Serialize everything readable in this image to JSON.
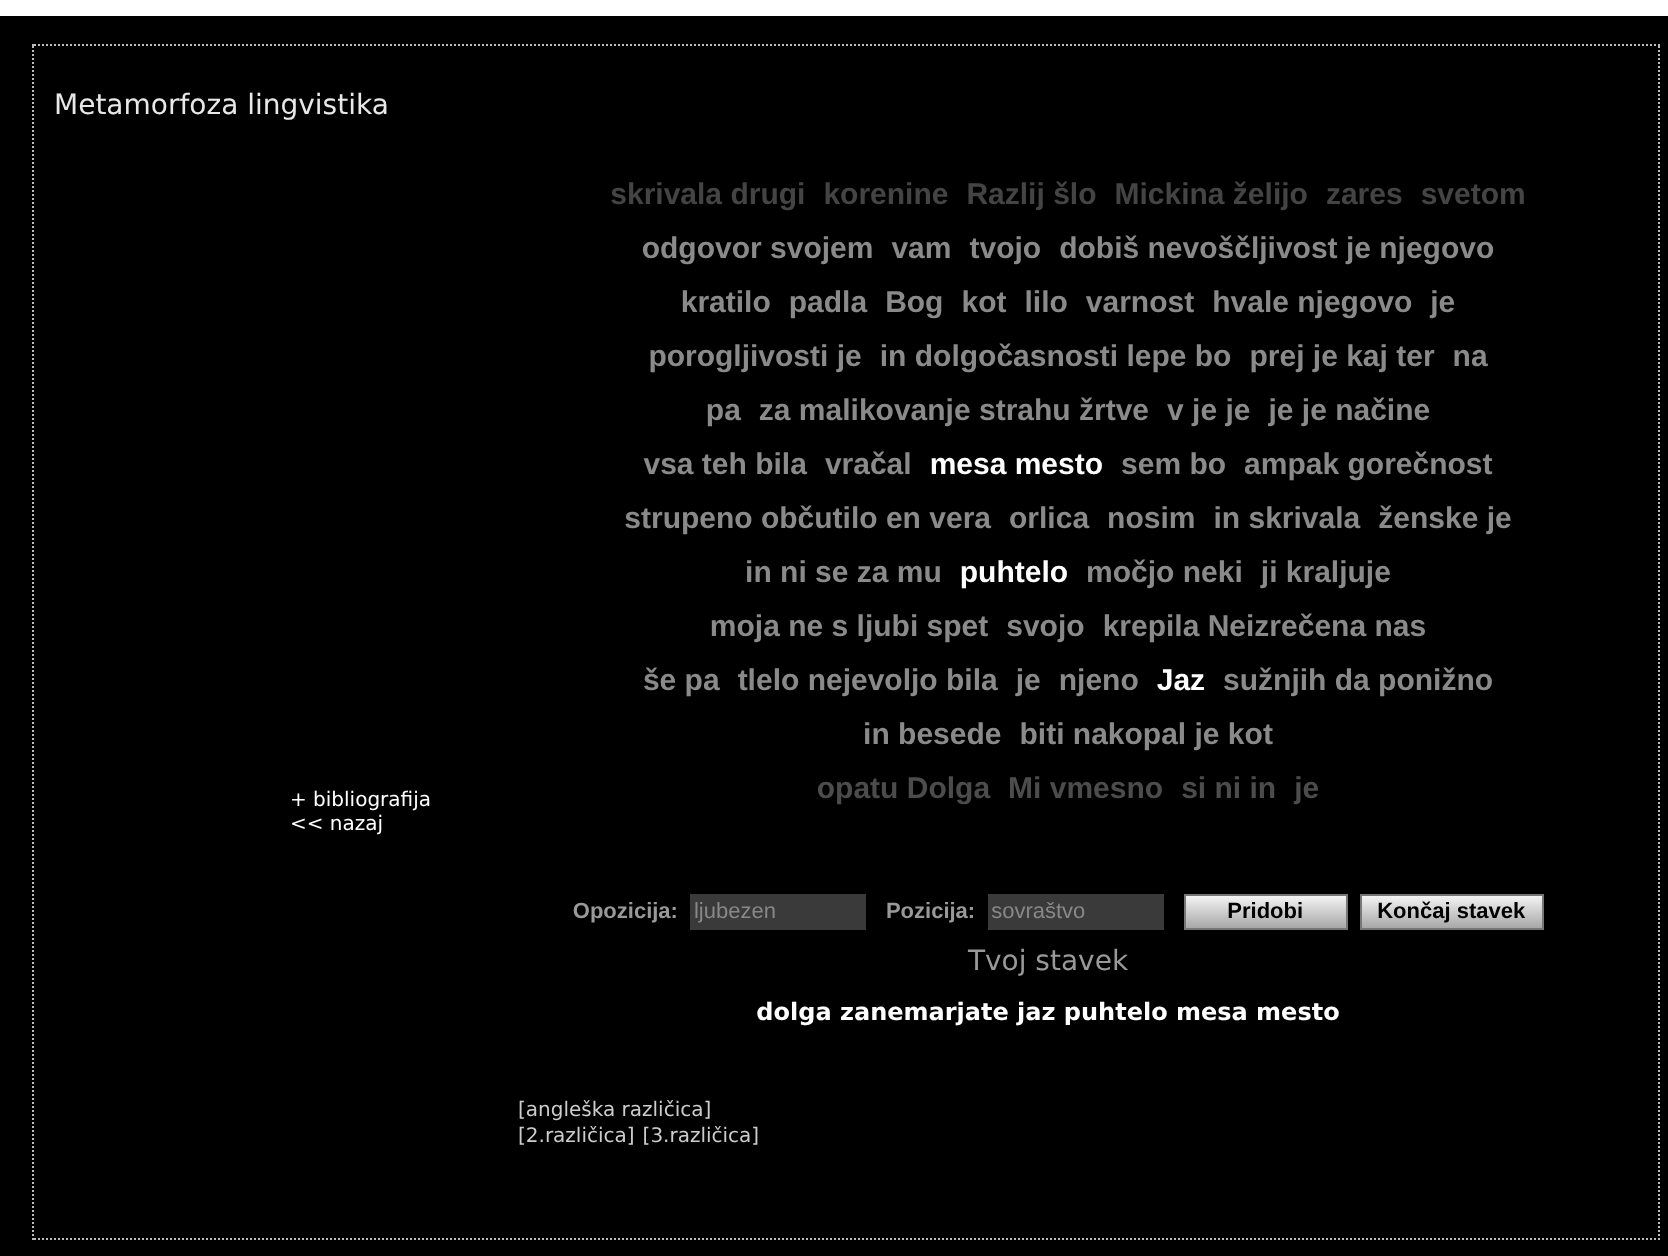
{
  "title": "Metamorfoza lingvistika",
  "nav_links": [
    "+ bibliografija",
    "<< nazaj"
  ],
  "word_cloud": [
    {
      "color": "#444444",
      "chunks": [
        {
          "text": "skrivala drugi",
          "highlighted": false
        },
        {
          "text": "korenine",
          "highlighted": false
        },
        {
          "text": "Razlij šlo",
          "highlighted": false
        },
        {
          "text": "Mickina želijo",
          "highlighted": false
        },
        {
          "text": "zares",
          "highlighted": false
        },
        {
          "text": "svetom",
          "highlighted": false
        }
      ]
    },
    {
      "color": "#8a8a8a",
      "chunks": [
        {
          "text": "odgovor svojem",
          "highlighted": false
        },
        {
          "text": "vam",
          "highlighted": false
        },
        {
          "text": "tvojo",
          "highlighted": false
        },
        {
          "text": "dobiš nevoščljivost je njegovo",
          "highlighted": false
        }
      ]
    },
    {
      "color": "#8a8a8a",
      "chunks": [
        {
          "text": "kratilo",
          "highlighted": false
        },
        {
          "text": "padla",
          "highlighted": false
        },
        {
          "text": "Bog",
          "highlighted": false
        },
        {
          "text": "kot",
          "highlighted": false
        },
        {
          "text": "lilo",
          "highlighted": false
        },
        {
          "text": "varnost",
          "highlighted": false
        },
        {
          "text": "hvale njegovo",
          "highlighted": false
        },
        {
          "text": "je",
          "highlighted": false
        }
      ]
    },
    {
      "color": "#8a8a8a",
      "chunks": [
        {
          "text": "porogljivosti je",
          "highlighted": false
        },
        {
          "text": "in dolgočasnosti lepe bo",
          "highlighted": false
        },
        {
          "text": "prej je kaj ter",
          "highlighted": false
        },
        {
          "text": "na",
          "highlighted": false
        }
      ]
    },
    {
      "color": "#8a8a8a",
      "chunks": [
        {
          "text": "pa",
          "highlighted": false
        },
        {
          "text": "za malikovanje strahu žrtve",
          "highlighted": false
        },
        {
          "text": "v je je",
          "highlighted": false
        },
        {
          "text": "je je načine",
          "highlighted": false
        }
      ]
    },
    {
      "color": "#8a8a8a",
      "chunks": [
        {
          "text": "vsa teh bila",
          "highlighted": false
        },
        {
          "text": "vračal",
          "highlighted": false
        },
        {
          "text": "mesa mesto",
          "highlighted": true
        },
        {
          "text": "sem bo",
          "highlighted": false
        },
        {
          "text": "ampak gorečnost",
          "highlighted": false
        }
      ]
    },
    {
      "color": "#8a8a8a",
      "chunks": [
        {
          "text": "strupeno občutilo en vera",
          "highlighted": false
        },
        {
          "text": "orlica",
          "highlighted": false
        },
        {
          "text": "nosim",
          "highlighted": false
        },
        {
          "text": "in skrivala",
          "highlighted": false
        },
        {
          "text": "ženske je",
          "highlighted": false
        }
      ]
    },
    {
      "color": "#8a8a8a",
      "chunks": [
        {
          "text": "in ni se za mu",
          "highlighted": false
        },
        {
          "text": "puhtelo",
          "highlighted": true
        },
        {
          "text": "močjo neki",
          "highlighted": false
        },
        {
          "text": "ji kraljuje",
          "highlighted": false
        }
      ]
    },
    {
      "color": "#8a8a8a",
      "chunks": [
        {
          "text": "moja ne s ljubi spet",
          "highlighted": false
        },
        {
          "text": "svojo",
          "highlighted": false
        },
        {
          "text": "krepila Neizrečena nas",
          "highlighted": false
        }
      ]
    },
    {
      "color": "#8a8a8a",
      "chunks": [
        {
          "text": "še pa",
          "highlighted": false
        },
        {
          "text": "tlelo nejevoljo bila",
          "highlighted": false
        },
        {
          "text": "je",
          "highlighted": false
        },
        {
          "text": "njeno",
          "highlighted": false
        },
        {
          "text": "Jaz",
          "highlighted": true
        },
        {
          "text": "sužnjih da ponižno",
          "highlighted": false
        }
      ]
    },
    {
      "color": "#8a8a8a",
      "chunks": [
        {
          "text": "in besede",
          "highlighted": false
        },
        {
          "text": "biti nakopal je kot",
          "highlighted": false
        }
      ]
    },
    {
      "color": "#4c4c4c",
      "chunks": [
        {
          "text": "opatu Dolga",
          "highlighted": false
        },
        {
          "text": "Mi vmesno",
          "highlighted": false
        },
        {
          "text": "si ni in",
          "highlighted": false
        },
        {
          "text": "je",
          "highlighted": false
        }
      ]
    }
  ],
  "form": {
    "fields": [
      {
        "label": "Opozicija:",
        "value": "ljubezen"
      },
      {
        "label": "Pozicija:",
        "value": "sovraštvo"
      }
    ],
    "buttons": [
      "Pridobi",
      "Končaj stavek"
    ]
  },
  "sentence_heading": "Tvoj stavek",
  "sentence": "dolga zanemarjate jaz puhtelo mesa mesto",
  "version_links": [
    [
      "[angleška različica]"
    ],
    [
      "[2.različica]",
      "[3.različica]"
    ]
  ]
}
